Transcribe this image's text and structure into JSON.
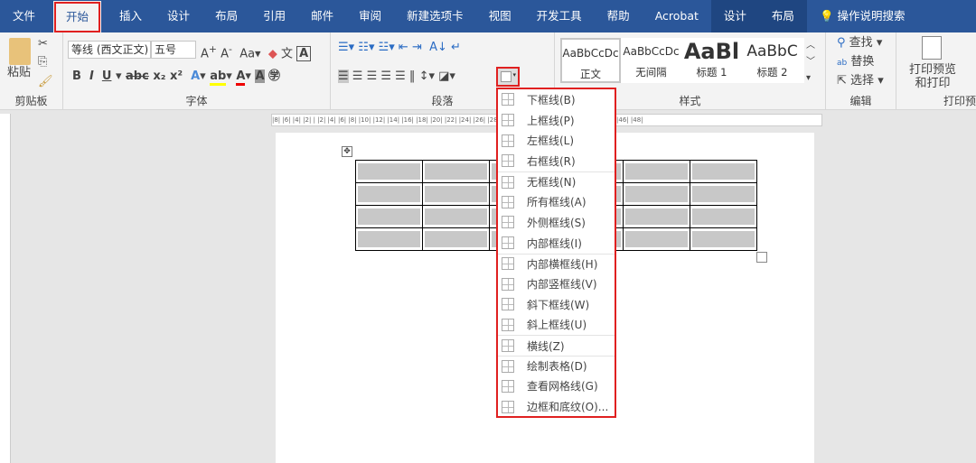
{
  "tabs": [
    "文件",
    "开始",
    "插入",
    "设计",
    "布局",
    "引用",
    "邮件",
    "审阅",
    "新建选项卡",
    "视图",
    "开发工具",
    "帮助",
    "Acrobat",
    "设计",
    "布局"
  ],
  "tell_me": "操作说明搜索",
  "clipboard": {
    "paste": "粘贴",
    "label": "剪贴板"
  },
  "font": {
    "name": "等线 (西文正文)",
    "size": "五号",
    "label": "字体"
  },
  "paragraph": {
    "label": "段落"
  },
  "styles": {
    "items": [
      {
        "preview": "AaBbCcDc",
        "name": "正文"
      },
      {
        "preview": "AaBbCcDc",
        "name": "无间隔"
      },
      {
        "preview": "AaBl",
        "name": "标题 1"
      },
      {
        "preview": "AaBbC",
        "name": "标题 2"
      }
    ],
    "label": "样式"
  },
  "editing": {
    "find": "查找",
    "replace": "替换",
    "select": "选择",
    "label": "编辑"
  },
  "print": {
    "button": "打印预览和打印",
    "label": "打印预"
  },
  "ruler": "|8| |6| |4| |2| | |2| |4| |6| |8| |10| |12| |14| |16| |18| |20| |22| |24| |26| |28| |30| |32| |34| |36| |38| |40| |42| |44| |46| |48|",
  "border_menu": [
    {
      "label": "下框线(B)",
      "icon": "bottom-border-icon"
    },
    {
      "label": "上框线(P)",
      "icon": "top-border-icon"
    },
    {
      "label": "左框线(L)",
      "icon": "left-border-icon"
    },
    {
      "label": "右框线(R)",
      "icon": "right-border-icon"
    },
    {
      "label": "无框线(N)",
      "icon": "no-border-icon",
      "sep": true
    },
    {
      "label": "所有框线(A)",
      "icon": "all-borders-icon"
    },
    {
      "label": "外侧框线(S)",
      "icon": "outside-borders-icon"
    },
    {
      "label": "内部框线(I)",
      "icon": "inside-borders-icon"
    },
    {
      "label": "内部横框线(H)",
      "icon": "inside-horizontal-border-icon",
      "sep": true
    },
    {
      "label": "内部竖框线(V)",
      "icon": "inside-vertical-border-icon"
    },
    {
      "label": "斜下框线(W)",
      "icon": "diagonal-down-border-icon"
    },
    {
      "label": "斜上框线(U)",
      "icon": "diagonal-up-border-icon"
    },
    {
      "label": "横线(Z)",
      "icon": "horizontal-line-icon",
      "sep": true
    },
    {
      "label": "绘制表格(D)",
      "icon": "draw-table-icon",
      "sep": true
    },
    {
      "label": "查看网格线(G)",
      "icon": "view-gridlines-icon"
    },
    {
      "label": "边框和底纹(O)...",
      "icon": "borders-shading-icon"
    }
  ]
}
